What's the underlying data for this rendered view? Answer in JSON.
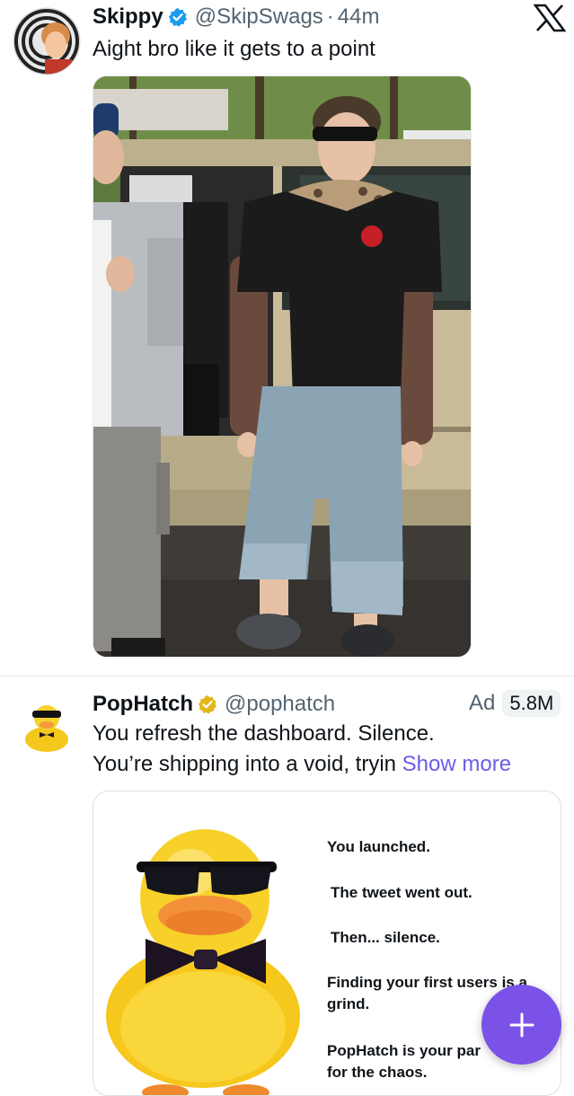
{
  "tweet1": {
    "display_name": "Skippy",
    "handle": "@SkipSwags",
    "separator": "·",
    "time": "44m",
    "text": "Aight bro like it gets to a point"
  },
  "tweet2": {
    "display_name": "PopHatch",
    "handle": "@pophatch",
    "ad_label": "Ad",
    "views": "5.8M",
    "text_line1": "You refresh the dashboard. Silence.",
    "text_line2": "You’re shipping into a void, tryin",
    "show_more": "Show more",
    "card_lines": [
      "You launched.",
      "The tweet went out.",
      "Then... silence.",
      "Finding your first users is a",
      "grind.",
      "PopHatch is your par",
      "for the chaos."
    ]
  },
  "colors": {
    "accent": "#6b5ce7",
    "verified": "#1d9bf0",
    "gold_verified": "#e2b719",
    "fab": "#7b52e8",
    "muted_text": "#536471"
  },
  "icons": {
    "brand": "x-logo-icon",
    "verified": "verified-badge-icon",
    "compose": "plus-icon"
  }
}
